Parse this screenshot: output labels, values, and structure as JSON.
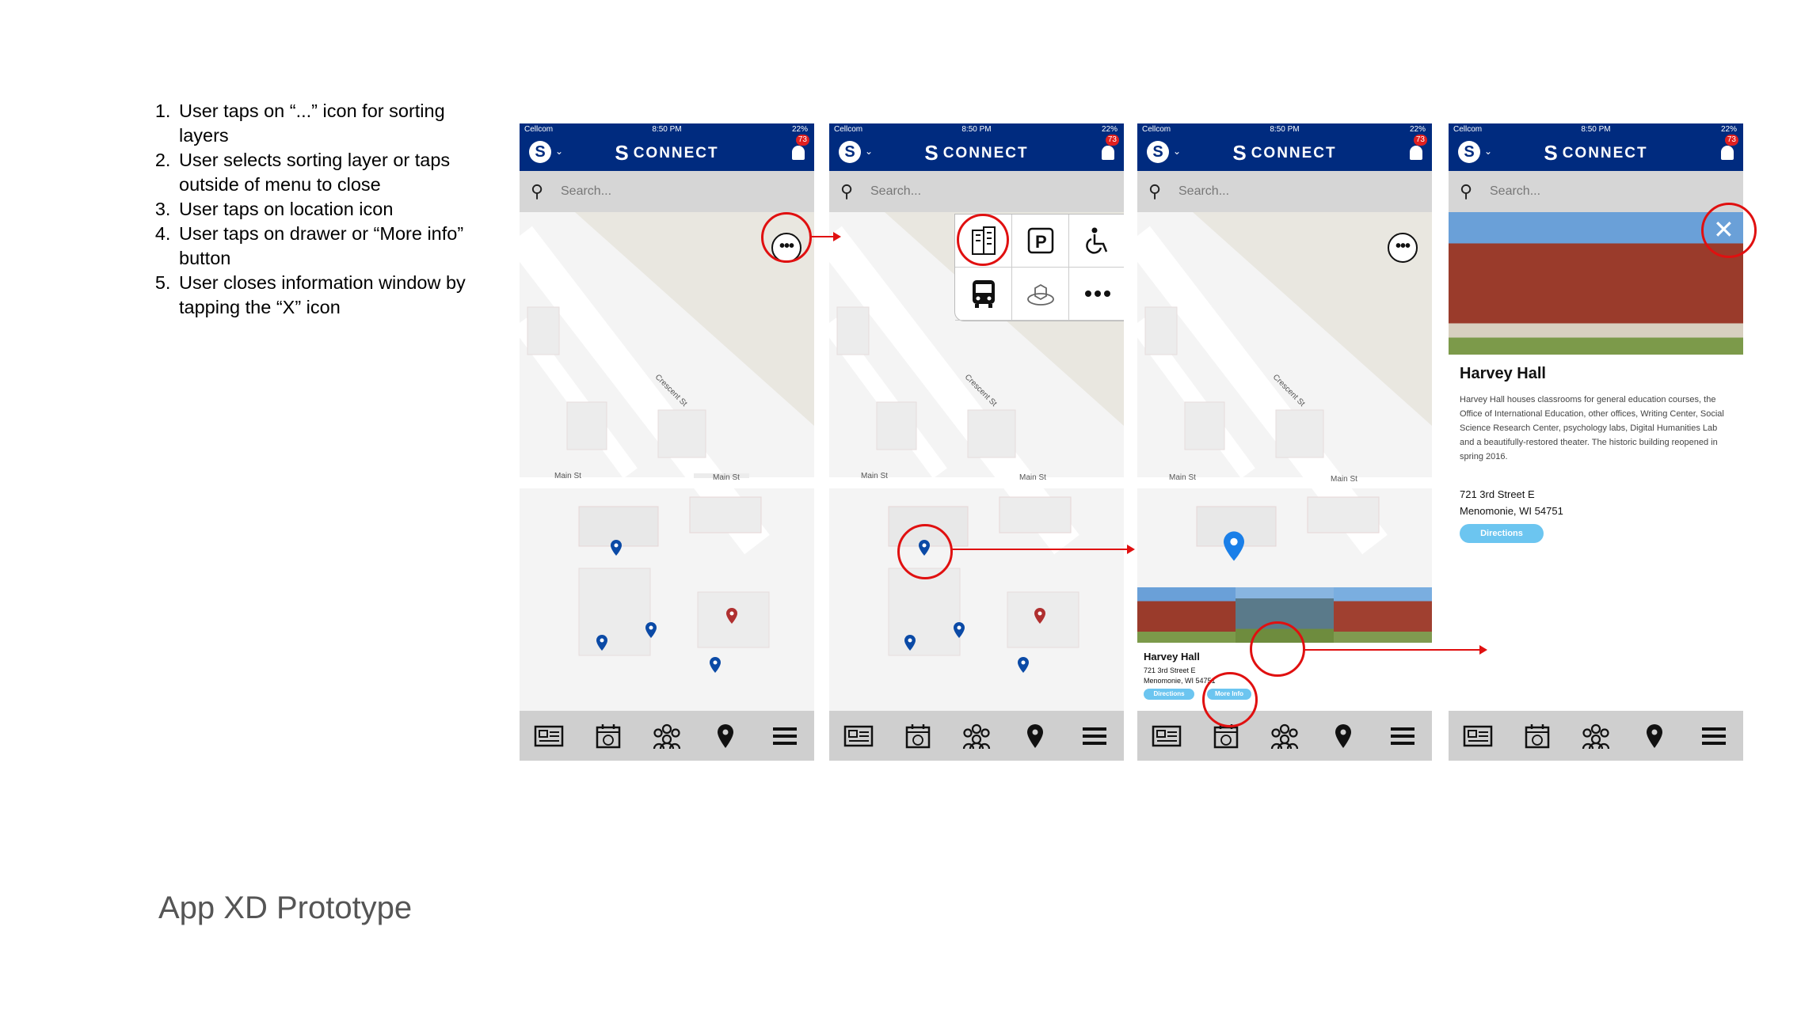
{
  "steps": [
    "User taps on “...” icon for sorting layers",
    "User selects sorting layer or taps outside of menu to close",
    "User taps on location icon",
    "User taps on drawer or “More info” button",
    "User closes information window by tapping the “X” icon"
  ],
  "caption": "App XD Prototype",
  "phone": {
    "carrier": "Cellcom",
    "time": "8:50 PM",
    "battery": "22%",
    "brand": "CONNECT",
    "notifications": "73",
    "search_placeholder": "Search...",
    "street_main": "Main St",
    "street_crescent": "Crescent St"
  },
  "building": {
    "name": "Harvey Hall",
    "description": "Harvey Hall houses classrooms for general education courses, the Office of International Education, other offices, Writing Center, Social Science Research Center, psychology labs, Digital Humanities Lab and a beautifully-restored theater. The historic building reopened in spring 2016.",
    "address_line1": "721 3rd Street E",
    "address_line2": "Menomonie, WI 54751",
    "drawer_address_line1": "721 3rd Street E",
    "drawer_address_line2": "Menomonie, WI 54751",
    "directions_label": "Directions",
    "more_info_label": "More Info"
  },
  "icons": {
    "tabs": [
      "news-icon",
      "calendar-icon",
      "groups-icon",
      "location-icon",
      "menu-icon"
    ],
    "layers": [
      "building-icon",
      "parking-icon",
      "accessibility-icon",
      "bus-icon",
      "package-icon",
      "more-icon"
    ]
  },
  "colors": {
    "header": "#002b7f",
    "highlight": "#e01010",
    "pin_blue": "#0b4aa6",
    "pin_red": "#b03030",
    "button": "#6cc5f0"
  }
}
